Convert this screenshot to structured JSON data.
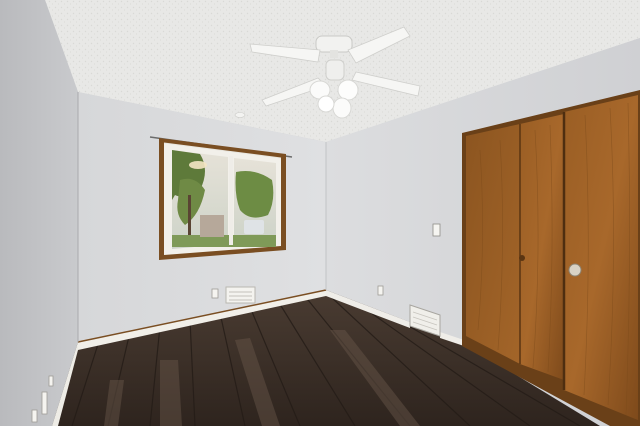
{
  "photo": {
    "subject": "empty bedroom",
    "colors": {
      "ceiling": "#e9e9e7",
      "wall_left": "#c4c5c8",
      "wall_back": "#d9dadc",
      "wall_right": "#d5d6d8",
      "floor_dark": "#3a2e26",
      "floor_light": "#5a4a3e",
      "baseboard": "#f1efe9",
      "trim_wood": "#7a4e22",
      "closet_wood": "#8a5420",
      "closet_wood_light": "#a8682b",
      "fan_white": "#f4f4f2",
      "foliage": "#6f8a45"
    },
    "icons": [
      "ceiling-fan",
      "window",
      "closet-door",
      "floor-vent",
      "wall-vent",
      "light-switch",
      "electrical-outlet",
      "door-knob",
      "curtain-rod"
    ]
  }
}
